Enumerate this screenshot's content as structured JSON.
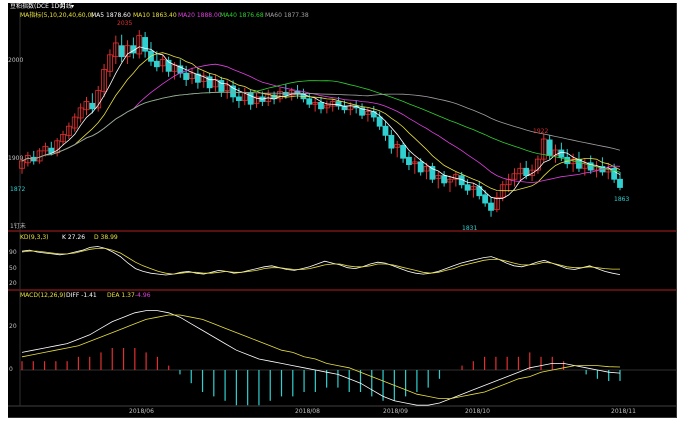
{
  "header": {
    "symbol_label": "豆粕指数(DCE 1D0)",
    "period_label": "月线",
    "period_dropdown": "▾"
  },
  "main_panel": {
    "ma_label": "MA指标(5,10,20,40,60,0)",
    "ma5_text": "MA5 1878.60",
    "ma10_text": "MA10 1863.40",
    "ma20_text": "MA20 1888.00",
    "ma40_text": "MA40 1876.68",
    "ma60_text": "MA60 1877.38",
    "peak_label": "2035",
    "low_label": "1831",
    "mid_high_label": "1922",
    "last_label": "1863",
    "left_low_label": "1872",
    "y_ticks": [
      "2000",
      "1900"
    ],
    "footer_note": "1钉未"
  },
  "kd_panel": {
    "label": "KD(9,3,3)",
    "k_text": "K 27.26",
    "d_text": "D 38.99",
    "y_ticks": [
      "90",
      "50",
      "20"
    ]
  },
  "macd_panel": {
    "label": "MACD(12,26,9)",
    "dif_text": "DIFF -1.41",
    "dea_text": "DEA 1.37",
    "macd_text": "-4.96",
    "y_ticks": [
      "20",
      "0"
    ]
  },
  "x_axis": [
    "2018/06",
    "2018/08",
    "2018/09",
    "2018/10",
    "2018/11"
  ],
  "colors": {
    "background": "#000000",
    "up": "#e03030",
    "down": "#30d0d0",
    "ma5": "#ffffff",
    "ma10": "#e8e040",
    "ma20": "#e040e0",
    "ma40": "#30d030",
    "ma60": "#a0a0a0",
    "divider": "#b02020"
  },
  "chart_data": [
    {
      "type": "candlestick",
      "title": "豆粕指数(DCE 1D0)",
      "candles": [
        [
          1884,
          1896,
          1878,
          1892
        ],
        [
          1890,
          1902,
          1886,
          1898
        ],
        [
          1896,
          1903,
          1888,
          1892
        ],
        [
          1892,
          1906,
          1889,
          1903
        ],
        [
          1903,
          1912,
          1897,
          1908
        ],
        [
          1906,
          1913,
          1898,
          1901
        ],
        [
          1901,
          1917,
          1897,
          1914
        ],
        [
          1913,
          1925,
          1909,
          1921
        ],
        [
          1920,
          1934,
          1916,
          1930
        ],
        [
          1928,
          1944,
          1924,
          1940
        ],
        [
          1939,
          1955,
          1934,
          1950
        ],
        [
          1948,
          1962,
          1942,
          1957
        ],
        [
          1955,
          1966,
          1944,
          1949
        ],
        [
          1950,
          1974,
          1946,
          1969
        ],
        [
          1968,
          1998,
          1962,
          1992
        ],
        [
          1990,
          2014,
          1984,
          2008
        ],
        [
          2006,
          2029,
          1998,
          2021
        ],
        [
          2018,
          2030,
          2000,
          2006
        ],
        [
          2006,
          2024,
          1998,
          2018
        ],
        [
          2018,
          2027,
          2004,
          2010
        ],
        [
          2009,
          2035,
          2004,
          2029
        ],
        [
          2027,
          2033,
          2005,
          2012
        ],
        [
          2012,
          2022,
          1996,
          2001
        ],
        [
          2001,
          2012,
          1990,
          1995
        ],
        [
          1996,
          2008,
          1989,
          2003
        ],
        [
          2002,
          2006,
          1984,
          1990
        ],
        [
          1990,
          2000,
          1981,
          1997
        ],
        [
          1996,
          2003,
          1983,
          1988
        ],
        [
          1988,
          1996,
          1974,
          1981
        ],
        [
          1982,
          1994,
          1976,
          1988
        ],
        [
          1987,
          1993,
          1971,
          1978
        ],
        [
          1979,
          1990,
          1972,
          1985
        ],
        [
          1984,
          1988,
          1966,
          1972
        ],
        [
          1973,
          1986,
          1968,
          1981
        ],
        [
          1980,
          1984,
          1962,
          1968
        ],
        [
          1969,
          1980,
          1960,
          1975
        ],
        [
          1974,
          1980,
          1956,
          1962
        ],
        [
          1962,
          1972,
          1950,
          1958
        ],
        [
          1958,
          1972,
          1953,
          1967
        ],
        [
          1966,
          1970,
          1948,
          1954
        ],
        [
          1955,
          1966,
          1950,
          1962
        ],
        [
          1962,
          1968,
          1952,
          1957
        ],
        [
          1957,
          1970,
          1952,
          1965
        ],
        [
          1964,
          1968,
          1954,
          1960
        ],
        [
          1960,
          1972,
          1956,
          1968
        ],
        [
          1967,
          1976,
          1960,
          1964
        ],
        [
          1964,
          1972,
          1958,
          1969
        ],
        [
          1968,
          1975,
          1960,
          1965
        ],
        [
          1965,
          1971,
          1956,
          1960
        ],
        [
          1960,
          1966,
          1950,
          1954
        ],
        [
          1954,
          1960,
          1946,
          1956
        ],
        [
          1956,
          1962,
          1944,
          1949
        ],
        [
          1950,
          1958,
          1944,
          1953
        ],
        [
          1952,
          1960,
          1946,
          1957
        ],
        [
          1957,
          1962,
          1948,
          1952
        ],
        [
          1952,
          1958,
          1944,
          1948
        ],
        [
          1948,
          1956,
          1942,
          1952
        ],
        [
          1952,
          1958,
          1944,
          1950
        ],
        [
          1950,
          1955,
          1938,
          1942
        ],
        [
          1943,
          1950,
          1935,
          1946
        ]
      ]
    },
    {
      "type": "candlestick",
      "candles": [
        [
          1946,
          1952,
          1935,
          1940
        ],
        [
          1940,
          1946,
          1926,
          1930
        ],
        [
          1930,
          1936,
          1914,
          1920
        ],
        [
          1920,
          1926,
          1900,
          1906
        ],
        [
          1907,
          1914,
          1896,
          1910
        ],
        [
          1909,
          1912,
          1890,
          1895
        ],
        [
          1896,
          1902,
          1882,
          1888
        ],
        [
          1889,
          1896,
          1878,
          1891
        ],
        [
          1891,
          1895,
          1876,
          1880
        ],
        [
          1881,
          1890,
          1872,
          1886
        ],
        [
          1886,
          1890,
          1868,
          1872
        ],
        [
          1873,
          1880,
          1862,
          1876
        ],
        [
          1876,
          1881,
          1864,
          1868
        ],
        [
          1869,
          1876,
          1858,
          1872
        ],
        [
          1872,
          1880,
          1864,
          1877
        ],
        [
          1876,
          1880,
          1862,
          1866
        ],
        [
          1866,
          1872,
          1855,
          1860
        ],
        [
          1861,
          1868,
          1852,
          1864
        ],
        [
          1864,
          1870,
          1850,
          1854
        ],
        [
          1855,
          1860,
          1842,
          1846
        ],
        [
          1846,
          1852,
          1831,
          1838
        ],
        [
          1839,
          1858,
          1836,
          1852
        ],
        [
          1852,
          1870,
          1848,
          1866
        ],
        [
          1866,
          1878,
          1858,
          1872
        ],
        [
          1872,
          1884,
          1864,
          1878
        ],
        [
          1878,
          1890,
          1870,
          1884
        ],
        [
          1884,
          1892,
          1872,
          1876
        ],
        [
          1876,
          1888,
          1870,
          1882
        ],
        [
          1882,
          1898,
          1878,
          1894
        ],
        [
          1894,
          1922,
          1890,
          1916
        ],
        [
          1915,
          1920,
          1894,
          1898
        ],
        [
          1898,
          1910,
          1890,
          1904
        ],
        [
          1904,
          1912,
          1892,
          1896
        ],
        [
          1896,
          1905,
          1884,
          1889
        ],
        [
          1889,
          1900,
          1880,
          1894
        ],
        [
          1894,
          1902,
          1880,
          1884
        ],
        [
          1884,
          1894,
          1876,
          1890
        ],
        [
          1890,
          1898,
          1878,
          1882
        ],
        [
          1882,
          1892,
          1874,
          1886
        ],
        [
          1886,
          1896,
          1876,
          1880
        ],
        [
          1880,
          1890,
          1872,
          1884
        ],
        [
          1884,
          1889,
          1868,
          1872
        ],
        [
          1872,
          1880,
          1860,
          1863
        ]
      ]
    },
    {
      "type": "line",
      "title": "KD(9,3,3)",
      "series": [
        {
          "name": "K",
          "values": [
            78,
            80,
            76,
            74,
            72,
            70,
            72,
            76,
            80,
            86,
            88,
            84,
            76,
            66,
            52,
            40,
            34,
            30,
            28,
            26,
            28,
            32,
            34,
            30,
            28,
            32,
            36,
            34,
            30,
            32,
            36,
            40,
            44,
            46,
            42,
            38,
            36,
            40,
            44,
            50,
            56,
            52,
            48,
            42,
            40,
            44,
            50,
            54,
            52,
            46,
            40,
            34,
            30,
            28,
            30,
            34,
            40,
            46,
            52,
            56,
            60,
            64,
            66,
            60,
            52,
            46,
            44,
            48,
            54,
            58,
            52,
            46,
            40,
            38,
            42,
            46,
            40,
            34,
            30,
            27
          ]
        },
        {
          "name": "D",
          "values": [
            76,
            78,
            78,
            76,
            74,
            72,
            72,
            74,
            78,
            82,
            84,
            84,
            80,
            74,
            64,
            54,
            46,
            40,
            34,
            30,
            28,
            30,
            32,
            32,
            30,
            30,
            32,
            34,
            32,
            32,
            34,
            36,
            40,
            42,
            42,
            40,
            38,
            38,
            40,
            44,
            48,
            50,
            50,
            46,
            44,
            44,
            46,
            50,
            50,
            48,
            44,
            40,
            36,
            32,
            30,
            32,
            36,
            40,
            46,
            50,
            54,
            58,
            60,
            60,
            56,
            52,
            48,
            48,
            50,
            54,
            52,
            48,
            44,
            42,
            42,
            44,
            42,
            40,
            39,
            38.99
          ]
        }
      ],
      "ylim": [
        0,
        100
      ]
    },
    {
      "type": "bar",
      "title": "MACD(12,26,9)",
      "series": [
        {
          "name": "DIFF",
          "values": [
            8,
            9,
            10,
            11,
            12,
            14,
            16,
            19,
            22,
            24,
            26,
            27,
            27,
            26,
            24,
            21,
            18,
            15,
            12,
            9,
            7,
            5,
            4,
            3,
            2,
            1,
            0,
            -1,
            -2,
            -4,
            -6,
            -9,
            -12,
            -14,
            -15,
            -16,
            -16,
            -15,
            -13,
            -11,
            -9,
            -7,
            -5,
            -3,
            -1,
            1,
            2,
            3,
            3,
            2,
            1,
            0,
            -1,
            -1.41
          ]
        },
        {
          "name": "DEA",
          "values": [
            6,
            7,
            8,
            9,
            10,
            11,
            13,
            15,
            17,
            19,
            21,
            23,
            24,
            25,
            25,
            24,
            23,
            21,
            19,
            17,
            15,
            13,
            11,
            9,
            8,
            6,
            5,
            3,
            2,
            1,
            -1,
            -3,
            -5,
            -7,
            -9,
            -11,
            -12,
            -13,
            -13,
            -12,
            -11,
            -10,
            -8,
            -6,
            -4,
            -3,
            -1,
            0,
            1,
            2,
            2,
            2,
            1.5,
            1.37
          ]
        },
        {
          "name": "MACD",
          "values": [
            4,
            4,
            4,
            4,
            4,
            6,
            6,
            8,
            10,
            10,
            10,
            8,
            6,
            2,
            -2,
            -6,
            -10,
            -12,
            -14,
            -16,
            -16,
            -16,
            -14,
            -12,
            -12,
            -10,
            -10,
            -8,
            -8,
            -10,
            -10,
            -12,
            -14,
            -14,
            -12,
            -10,
            -8,
            -4,
            0,
            2,
            4,
            6,
            6,
            6,
            6,
            8,
            6,
            6,
            4,
            0,
            -2,
            -4,
            -5,
            -4.96
          ]
        }
      ],
      "ylim": [
        -20,
        30
      ]
    }
  ]
}
